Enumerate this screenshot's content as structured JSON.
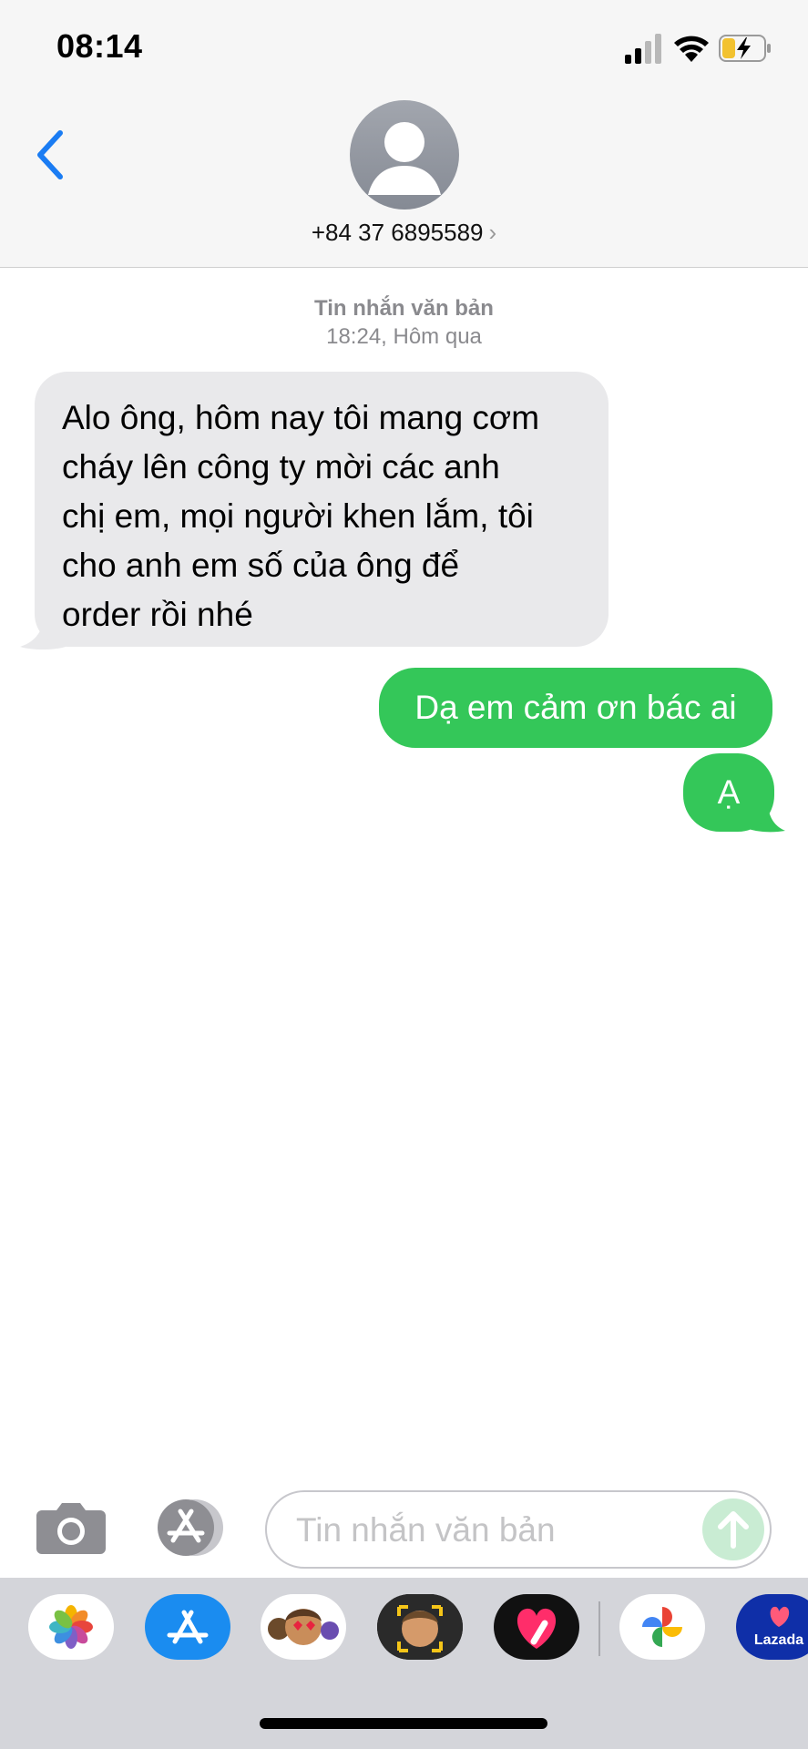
{
  "status_bar": {
    "time": "08:14"
  },
  "header": {
    "contact_number": "+84 37 6895589",
    "chevron": "›"
  },
  "conversation": {
    "service_label": "Tin nhắn văn bản",
    "timestamp": "18:24, Hôm qua",
    "messages": [
      {
        "direction": "incoming",
        "lines": [
          "Alo ông, hôm nay tôi mang cơm",
          "cháy lên công ty mời các anh",
          "chị em, mọi người khen lắm, tôi",
          "cho anh em số của ông để",
          "order rồi nhé"
        ]
      },
      {
        "direction": "outgoing",
        "text": "Dạ em cảm ơn bác ai"
      },
      {
        "direction": "outgoing",
        "text": "Ạ"
      }
    ]
  },
  "input": {
    "placeholder": "Tin nhắn văn bản"
  },
  "app_drawer": {
    "apps": [
      "photos-icon",
      "app-store-icon",
      "memoji-stickers-icon",
      "animoji-icon",
      "digital-touch-icon",
      "google-photos-icon",
      "lazada-icon"
    ],
    "lazada_label": "Lazada"
  },
  "colors": {
    "accent": "#1a7cf3",
    "outgoing_bubble": "#34c759",
    "incoming_bubble": "#e9e9eb"
  }
}
